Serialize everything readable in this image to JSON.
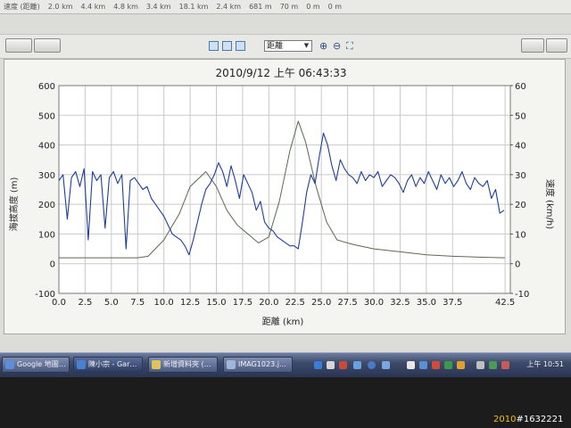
{
  "stats_bar": {
    "label": "速度 (距離)",
    "values": [
      "2.0 km",
      "4.4 km",
      "4.8 km",
      "3.4 km",
      "18.1 km",
      "2.4 km",
      "681 m",
      "70 m",
      "0 m",
      "0 m"
    ]
  },
  "toolbar": {
    "axis_select": "距離",
    "icons": [
      "chart-table-icon",
      "chart-split-icon",
      "chart-line-icon",
      "zoom-in-icon",
      "zoom-out-icon",
      "fit-icon"
    ]
  },
  "chart_data": {
    "type": "line",
    "title": "2010/9/12 上午 06:43:33",
    "xlabel": "距離 (km)",
    "ylabel": "海拔高度 (m)",
    "y2label": "速度 (km/h)",
    "xlim": [
      0,
      43
    ],
    "ylim": [
      -100,
      600
    ],
    "y2lim": [
      -10,
      60
    ],
    "x_ticks": [
      "0.0",
      "2.5",
      "5.0",
      "7.5",
      "10.0",
      "12.5",
      "15.0",
      "17.5",
      "20.0",
      "22.5",
      "25.0",
      "27.5",
      "30.0",
      "32.5",
      "35.0",
      "37.5",
      "42.5"
    ],
    "y_ticks": [
      "600",
      "500",
      "400",
      "300",
      "200",
      "100",
      "0",
      "-100"
    ],
    "y2_ticks": [
      "60",
      "50",
      "40",
      "30",
      "20",
      "10",
      "0",
      "-10"
    ],
    "grid": true,
    "series": [
      {
        "axis": "left",
        "color": "#5a6a52",
        "x": [
          0,
          2,
          5,
          7.5,
          8.5,
          10,
          11.5,
          12.5,
          14,
          15,
          16,
          17,
          18,
          19,
          20,
          21,
          22,
          22.8,
          23.5,
          24.5,
          25.5,
          26.5,
          28,
          30,
          32.5,
          35,
          37.5,
          40,
          42.5
        ],
        "values": [
          20,
          20,
          20,
          20,
          25,
          80,
          170,
          260,
          310,
          260,
          180,
          130,
          100,
          70,
          90,
          210,
          380,
          480,
          410,
          260,
          140,
          80,
          65,
          50,
          40,
          30,
          25,
          22,
          20
        ]
      },
      {
        "axis": "right",
        "color": "#1f3e9a",
        "x": [
          0,
          0.4,
          0.8,
          1.2,
          1.6,
          2.0,
          2.4,
          2.8,
          3.2,
          3.6,
          4.0,
          4.4,
          4.8,
          5.2,
          5.6,
          6.0,
          6.4,
          6.8,
          7.2,
          7.6,
          8.0,
          8.4,
          8.8,
          9.2,
          9.6,
          10.0,
          10.4,
          10.8,
          11.2,
          11.6,
          12.0,
          12.4,
          12.8,
          13.2,
          13.6,
          14.0,
          14.4,
          14.8,
          15.2,
          15.6,
          16.0,
          16.4,
          16.8,
          17.2,
          17.6,
          18.0,
          18.4,
          18.8,
          19.2,
          19.6,
          20.0,
          20.4,
          20.8,
          21.2,
          21.6,
          22.0,
          22.4,
          22.8,
          23.2,
          23.6,
          24.0,
          24.4,
          24.8,
          25.2,
          25.6,
          26.0,
          26.4,
          26.8,
          27.2,
          27.6,
          28.0,
          28.4,
          28.8,
          29.2,
          29.6,
          30.0,
          30.4,
          30.8,
          31.2,
          31.6,
          32.0,
          32.4,
          32.8,
          33.2,
          33.6,
          34.0,
          34.4,
          34.8,
          35.2,
          35.6,
          36.0,
          36.4,
          36.8,
          37.2,
          37.6,
          38.0,
          38.4,
          38.8,
          39.2,
          39.6,
          40.0,
          40.4,
          40.8,
          41.2,
          41.6,
          42.0,
          42.4
        ],
        "values": [
          28,
          30,
          15,
          29,
          31,
          26,
          32,
          8,
          31,
          28,
          30,
          12,
          29,
          31,
          27,
          30,
          5,
          28,
          29,
          27,
          25,
          26,
          22,
          20,
          18,
          16,
          13,
          10,
          9,
          8,
          6,
          3,
          8,
          14,
          20,
          25,
          27,
          30,
          34,
          31,
          26,
          33,
          28,
          22,
          30,
          27,
          24,
          18,
          21,
          14,
          12,
          11,
          9,
          8,
          7,
          6,
          6,
          5,
          14,
          24,
          30,
          27,
          36,
          44,
          40,
          33,
          28,
          35,
          32,
          30,
          29,
          27,
          31,
          28,
          30,
          29,
          31,
          26,
          28,
          30,
          29,
          27,
          24,
          28,
          30,
          26,
          29,
          27,
          31,
          28,
          25,
          30,
          27,
          29,
          26,
          28,
          31,
          27,
          25,
          29,
          27,
          26,
          28,
          22,
          25,
          17,
          18
        ]
      }
    ]
  },
  "taskbar": {
    "tasks": [
      "Google 地圖…",
      "陳小宗 - Gar…",
      "新增資料夾 (…",
      "IMAG1023.j…"
    ],
    "clock": "上午 10:51"
  },
  "watermark": {
    "year": "2010",
    "id": "#1632221"
  }
}
